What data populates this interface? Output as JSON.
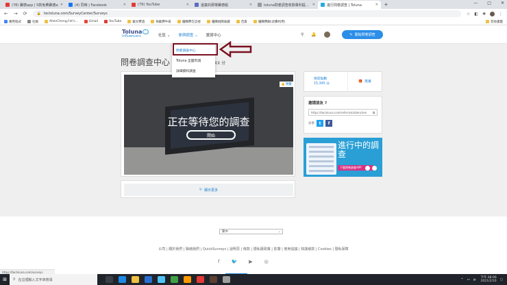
{
  "browser": {
    "tabs": [
      {
        "title": "(78) 賽德app | 5款免費賽德app...",
        "color": "#e53935"
      },
      {
        "title": "(4) 同時 | Facebook",
        "color": "#1877f2"
      },
      {
        "title": "(79) YouTube",
        "color": "#e53935"
      },
      {
        "title": "還童的那場賽德組",
        "color": "#5c6bc0"
      },
      {
        "title": "toluna問卷調查收款專利提...",
        "color": "#999999"
      },
      {
        "title": "進行問卷調查 | Toluna",
        "color": "#2aa9e0"
      }
    ],
    "new_tab": "+",
    "window_controls": [
      "—",
      "□",
      "✕"
    ],
    "url": "tw.toluna.com/SurveyCenter/Surveys",
    "bookmarks": [
      {
        "label": "應用程式",
        "color": "#4285f4"
      },
      {
        "label": "社群",
        "color": "#888888"
      },
      {
        "label": "AllenCheng,Fet's...",
        "color": "#f0c040"
      },
      {
        "label": "Gmail",
        "color": "#ea4335"
      },
      {
        "label": "YouTube",
        "color": "#e53935"
      },
      {
        "label": "藝文賽酒",
        "color": "#f0c040"
      },
      {
        "label": "佈藝賽牛排",
        "color": "#f0c040"
      },
      {
        "label": "優購賽在這裡",
        "color": "#f0c040"
      },
      {
        "label": "優購相關收藏",
        "color": "#f0c040"
      },
      {
        "label": "百貨",
        "color": "#f0c040"
      },
      {
        "label": "優購賽酬(退費利用)",
        "color": "#f0c040"
      }
    ],
    "bookmarks_right": "其他書籤",
    "status_url": "https://tw.toluna.com/surveys"
  },
  "site": {
    "logo_main": "Toluna",
    "logo_sub": "Influencers",
    "nav": [
      "社區",
      "參與調查",
      "獎賞中心"
    ],
    "start_button": "開始問卷調查",
    "dropdown": [
      "問卷調查中心",
      "Toluna 全國市調",
      "詳細資料調查"
    ]
  },
  "page": {
    "title": "問卷調查中心",
    "points": "XXX 分",
    "hero_title": "正在等待您的調查",
    "hero_button": "開始",
    "hero_badge": "預覽",
    "more_label": "顯示更多",
    "stats_label": "目前點數",
    "stats_value": "15,345 分",
    "stats_reward": "獎賞",
    "invite_title": "邀請朋友",
    "invite_link": "https://tw.toluna.com/referrals/allenchen",
    "share_label": "分享",
    "promo_title": "進行中的調查",
    "promo_bar": "下載問卷調查APP"
  },
  "footer": {
    "language": "繁中",
    "links": "公司 | 關於我們 | 聯絡我們 | QuickSurveys | 說明頁 | 條款 | 隱私權政策 | 影響 | 使用協議 | 知識條款 | Cookies | 隱私保障",
    "social": [
      "f",
      "🐦",
      "▶",
      "◎"
    ]
  },
  "taskbar": {
    "search_placeholder": "在這裡輸入文字來搜尋",
    "time": "下午 08:06",
    "date": "2021/2/10"
  }
}
